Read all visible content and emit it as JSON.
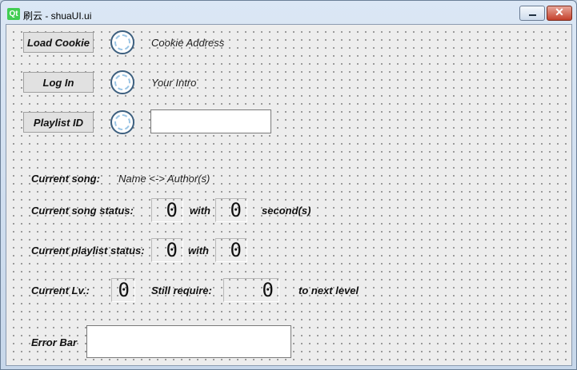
{
  "window": {
    "title": "刷云 - shuaUI.ui",
    "logo": "Qt"
  },
  "buttons": {
    "load_cookie": "Load Cookie",
    "log_in": "Log In",
    "playlist_id": "Playlist ID"
  },
  "labels": {
    "cookie_address": "Cookie Address",
    "your_intro": "Your Intro",
    "current_song": "Current song:",
    "song_name": "Name <-> Author(s)",
    "current_song_status": "Current song status:",
    "with": "with",
    "seconds": "second(s)",
    "current_playlist_status": "Current playlist status:",
    "current_lv": "Current Lv.:",
    "still_require": "Still require:",
    "to_next_level": "to next level",
    "error_bar": "Error Bar"
  },
  "inputs": {
    "playlist_id_value": "",
    "error_bar_value": ""
  },
  "lcd": {
    "song_status_a": "0",
    "song_status_b": "0",
    "playlist_status_a": "0",
    "playlist_status_b": "0",
    "current_lv": "0",
    "still_require": "0"
  }
}
